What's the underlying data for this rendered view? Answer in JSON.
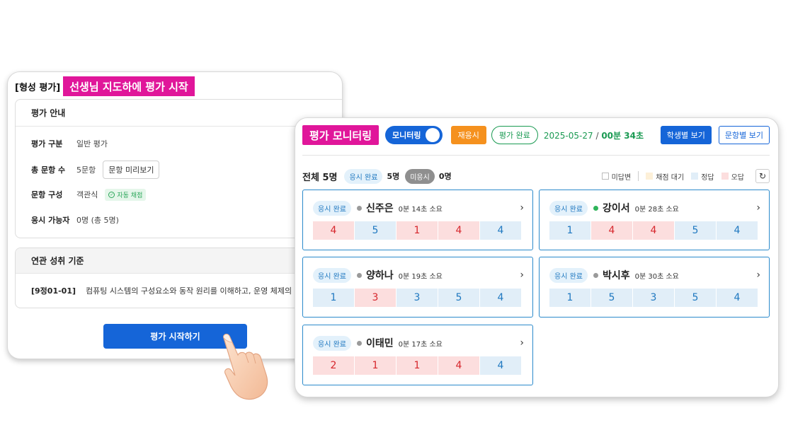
{
  "assessment": {
    "bracket_title": "[형성 평가]",
    "badge": "선생님 지도하에 평가 시작",
    "guide": {
      "title": "평가 안내",
      "rows": [
        {
          "label": "평가 구분",
          "value": "일반 평가"
        },
        {
          "label": "총 문항 수",
          "value": "5문항",
          "button": "문항 미리보기"
        },
        {
          "label": "문항 구성",
          "value": "객관식",
          "badge": "자동 채점"
        },
        {
          "label": "응시 가능자",
          "value": "0명 (총 5명)"
        }
      ]
    },
    "standard": {
      "title": "연관 성취 기준",
      "code": "[9정01-01]",
      "description": "컴퓨팅 시스템의 구성요소와 동작 원리를 이해하고, 운영 체제의 기능을 분"
    },
    "start_button": "평가 시작하기"
  },
  "monitor": {
    "title": "평가 모니터링",
    "toggle_label": "모니터링",
    "toggle_on": true,
    "retest_button": "재응시",
    "complete_button": "평가 완료",
    "date": "2025-05-27",
    "separator": "/",
    "elapsed": "00분 34초",
    "by_student_button": "학생별 보기",
    "by_question_button": "문항별 보기",
    "summary": {
      "total": "전체 5명",
      "done_label": "응시 완료",
      "done_count": "5명",
      "not_label": "미응시",
      "not_count": "0명"
    },
    "legend": {
      "unanswered": "미답변",
      "grading": "채점 대기",
      "correct": "정답",
      "wrong": "오답"
    },
    "students": [
      {
        "status": "응시 완료",
        "name": "신주은",
        "time": "0분 14초 소요",
        "dot_color": "#9a9a9a",
        "answers": [
          {
            "v": "4",
            "r": "wrong"
          },
          {
            "v": "5",
            "r": "correct"
          },
          {
            "v": "1",
            "r": "wrong"
          },
          {
            "v": "4",
            "r": "wrong"
          },
          {
            "v": "4",
            "r": "correct"
          }
        ]
      },
      {
        "status": "응시 완료",
        "name": "강이서",
        "time": "0분 28초 소요",
        "dot_color": "#2fb45a",
        "answers": [
          {
            "v": "1",
            "r": "correct"
          },
          {
            "v": "4",
            "r": "wrong"
          },
          {
            "v": "4",
            "r": "wrong"
          },
          {
            "v": "5",
            "r": "correct"
          },
          {
            "v": "4",
            "r": "correct"
          }
        ]
      },
      {
        "status": "응시 완료",
        "name": "양하나",
        "time": "0분 19초 소요",
        "dot_color": "#9a9a9a",
        "answers": [
          {
            "v": "1",
            "r": "correct"
          },
          {
            "v": "3",
            "r": "wrong"
          },
          {
            "v": "3",
            "r": "correct"
          },
          {
            "v": "5",
            "r": "correct"
          },
          {
            "v": "4",
            "r": "correct"
          }
        ]
      },
      {
        "status": "응시 완료",
        "name": "박시후",
        "time": "0분 30초 소요",
        "dot_color": "#9a9a9a",
        "answers": [
          {
            "v": "1",
            "r": "correct"
          },
          {
            "v": "5",
            "r": "correct"
          },
          {
            "v": "3",
            "r": "correct"
          },
          {
            "v": "5",
            "r": "correct"
          },
          {
            "v": "4",
            "r": "correct"
          }
        ]
      },
      {
        "status": "응시 완료",
        "name": "이태민",
        "time": "0분 17초 소요",
        "dot_color": "#9a9a9a",
        "answers": [
          {
            "v": "2",
            "r": "wrong"
          },
          {
            "v": "1",
            "r": "wrong"
          },
          {
            "v": "1",
            "r": "wrong"
          },
          {
            "v": "4",
            "r": "wrong"
          },
          {
            "v": "4",
            "r": "correct"
          }
        ]
      }
    ]
  },
  "colors": {
    "brand_magenta": "#e0169a",
    "primary_blue": "#1565d8",
    "success_green": "#1a9a52",
    "retest_orange": "#f5911e",
    "correct_bg": "#e1eef8",
    "wrong_bg": "#fcdede"
  },
  "icons": {
    "refresh": "refresh-icon",
    "chevron": "chevron-right-icon",
    "hand": "pointing-hand-icon"
  }
}
